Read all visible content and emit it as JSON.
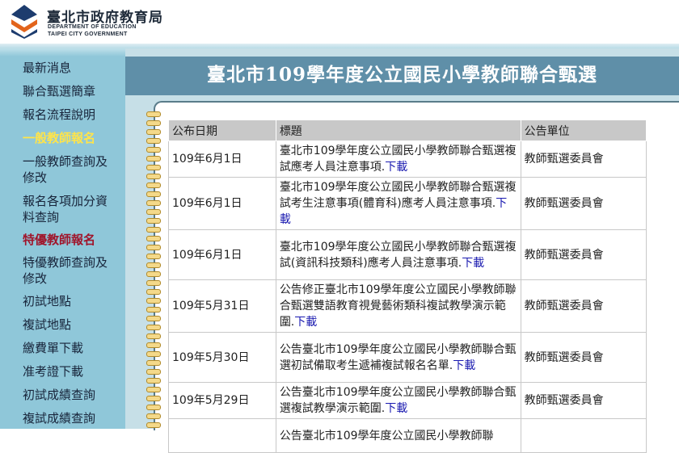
{
  "header": {
    "org_name_zh": "臺北市政府教育局",
    "org_name_en_1": "DEPARTMENT OF EDUCATION",
    "org_name_en_2": "TAIPEI CITY GOVERNMENT",
    "logo_icon": "department-logo-icon"
  },
  "sidebar": {
    "items": [
      {
        "label": "最新消息"
      },
      {
        "label": "聯合甄選簡章"
      },
      {
        "label": "報名流程說明"
      },
      {
        "label": "一般教師報名"
      },
      {
        "label": "一般教師查詢及修改"
      },
      {
        "label": "報名各項加分資料查詢"
      },
      {
        "label": "特優教師報名"
      },
      {
        "label": "特優教師查詢及修改"
      },
      {
        "label": "初試地點"
      },
      {
        "label": "複試地點"
      },
      {
        "label": "繳費單下載"
      },
      {
        "label": "准考證下載"
      },
      {
        "label": "初試成績查詢"
      },
      {
        "label": "複試成績查詢"
      }
    ]
  },
  "banner": {
    "title": "臺北市109學年度公立國民小學教師聯合甄選"
  },
  "table": {
    "headers": {
      "date": "公布日期",
      "title": "標題",
      "unit": "公告單位"
    },
    "rows": [
      {
        "date": "109年6月1日",
        "title": "臺北市109學年度公立國民小學教師聯合甄選複試應考人員注意事項.",
        "link": "下載",
        "unit": "教師甄選委員會"
      },
      {
        "date": "109年6月1日",
        "title": "臺北市109學年度公立國民小學教師聯合甄選複試考生注意事項(體育科)應考人員注意事項.",
        "link": "下載",
        "unit": "教師甄選委員會"
      },
      {
        "date": "109年6月1日",
        "title": "臺北市109學年度公立國民小學教師聯合甄選複試(資訊科技類科)應考人員注意事項.",
        "link": "下載",
        "unit": "教師甄選委員會"
      },
      {
        "date": "109年5月31日",
        "title": "公告修正臺北市109學年度公立國民小學教師聯合甄選雙語教育視覺藝術類科複試教學演示範圍.",
        "link": "下載",
        "unit": "教師甄選委員會"
      },
      {
        "date": "109年5月30日",
        "title": "公告臺北市109學年度公立國民小學教師聯合甄選初試備取考生遞補複試報名名單.",
        "link": "下載",
        "unit": "教師甄選委員會"
      },
      {
        "date": "109年5月29日",
        "title": "公告臺北市109學年度公立國民小學教師聯合甄選複試教學演示範圍.",
        "link": "下載",
        "unit": "教師甄選委員會"
      },
      {
        "date": "",
        "title": "公告臺北市109學年度公立國民小學教師聯",
        "link": "",
        "unit": ""
      }
    ]
  }
}
